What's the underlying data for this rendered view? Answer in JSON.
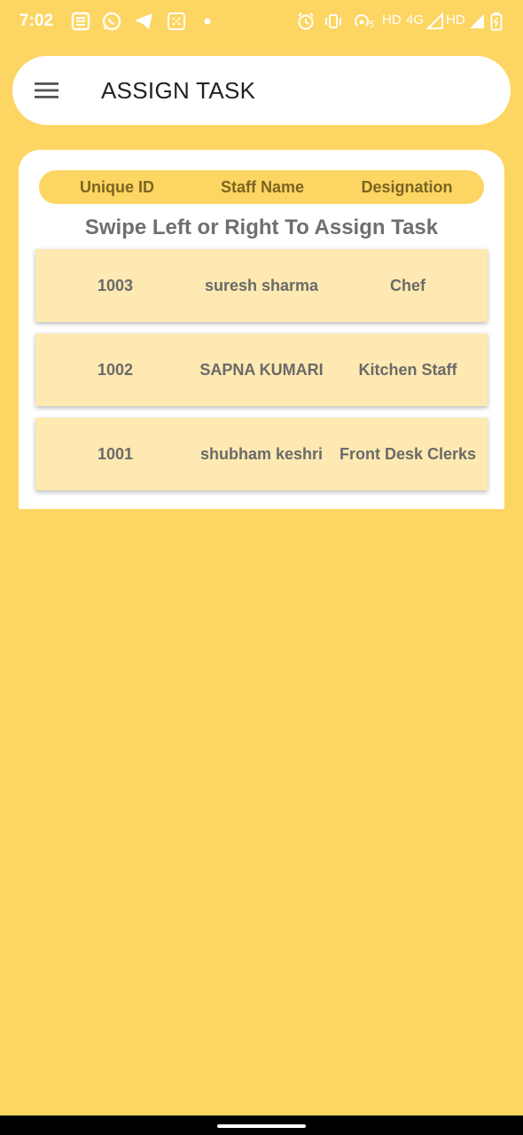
{
  "status_bar": {
    "time": "7:02",
    "hd1": "HD",
    "net": "4G",
    "hd2": "HD",
    "icons": [
      "news-icon",
      "whatsapp-icon",
      "telegram-icon",
      "grid-app-icon",
      "dot-icon",
      "alarm-icon",
      "vibrate-icon",
      "hotspot-icon",
      "signal-icon",
      "battery-icon"
    ],
    "icon_color": "#ffffff"
  },
  "header": {
    "title": "ASSIGN TASK",
    "menu_icon": "hamburger-menu-icon"
  },
  "table": {
    "columns": [
      "Unique ID",
      "Staff Name",
      "Designation"
    ],
    "hint": "Swipe Left or Right To Assign Task",
    "rows": [
      {
        "id": "1003",
        "name": "suresh sharma",
        "designation": "Chef"
      },
      {
        "id": "1002",
        "name": "SAPNA KUMARI",
        "designation": "Kitchen Staff"
      },
      {
        "id": "1001",
        "name": "shubham keshri",
        "designation": "Front Desk Clerks"
      }
    ]
  },
  "colors": {
    "background": "#fdd562",
    "card": "#ffffff",
    "row": "#fee9b2",
    "header_text": "#7a6522",
    "row_text": "#6a6a6a"
  }
}
